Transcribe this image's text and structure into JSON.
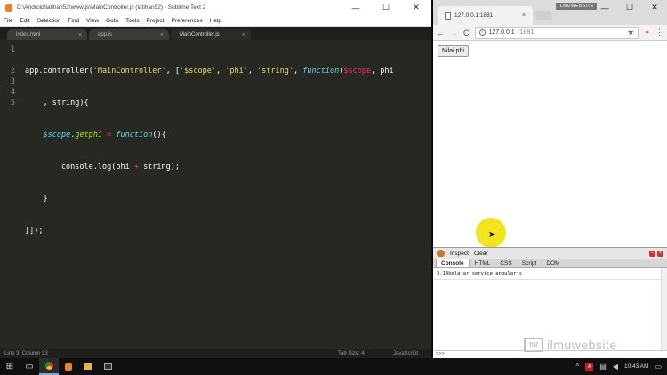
{
  "sublime": {
    "title": "D:\\Android\\latihan52\\www\\js\\MainController.js (latihan52) - Sublime Text 2",
    "menu": [
      "File",
      "Edit",
      "Selection",
      "Find",
      "View",
      "Goto",
      "Tools",
      "Project",
      "Preferences",
      "Help"
    ],
    "tabs": [
      {
        "label": "index.html",
        "close": "×"
      },
      {
        "label": "app.js",
        "close": "×"
      },
      {
        "label": "MainController.js",
        "close": "×"
      }
    ],
    "line_numbers": [
      "1",
      "",
      "2",
      "3",
      "4",
      "5"
    ],
    "code": {
      "l1_a": "app.controller(",
      "l1_b": "'MainController'",
      "l1_c": ", [",
      "l1_d": "'$scope'",
      "l1_e": ", ",
      "l1_f": "'phi'",
      "l1_g": ", ",
      "l1_h": "'string'",
      "l1_i": ", ",
      "l1_j": "function",
      "l1_k": "(",
      "l1_l": "$scope",
      "l1_m": ", phi",
      "l1w": "    , string){",
      "l2_a": "    ",
      "l2_b": "$scope",
      "l2_c": ".",
      "l2_d": "getphi",
      "l2_e": " = ",
      "l2_f": "function",
      "l2_g": "(){",
      "l3_a": "        console.log(phi ",
      "l3_b": "+",
      "l3_c": " string);",
      "l4": "    }",
      "l5": "}]);"
    },
    "status": {
      "position": "Line 3, Column 33",
      "tab_size": "Tab Size: 4",
      "syntax": "JavaScript"
    },
    "window_controls": [
      "—",
      "☐",
      "✕"
    ]
  },
  "chrome": {
    "tab_title": "127.0.0.1:1881",
    "tab_close": "×",
    "watermark": "ILMUWEBSITE",
    "window_controls": [
      "—",
      "☐",
      "✕"
    ],
    "url_host": "127.0.0.1",
    "url_port": ":1881",
    "nav": {
      "back": "←",
      "forward": "→",
      "reload": "C"
    },
    "star": "★",
    "menu": "⋮",
    "ext": "✦"
  },
  "page": {
    "button_label": "Nilai phi"
  },
  "firebug": {
    "inspect": "Inspect",
    "clear": "Clear",
    "tabs": [
      "Console",
      "HTML",
      "CSS",
      "Script",
      "DOM"
    ],
    "log_line": "3.14belajar service angularjs",
    "prompt": ">>>"
  },
  "brand": {
    "mark": "IW",
    "name": "ilmuwebsite"
  },
  "taskbar": {
    "clock": "10:43 AM",
    "icons": [
      "windows-start-icon",
      "task-view-icon",
      "chrome-icon",
      "sublime-icon",
      "explorer-icon",
      "cmd-icon"
    ]
  }
}
